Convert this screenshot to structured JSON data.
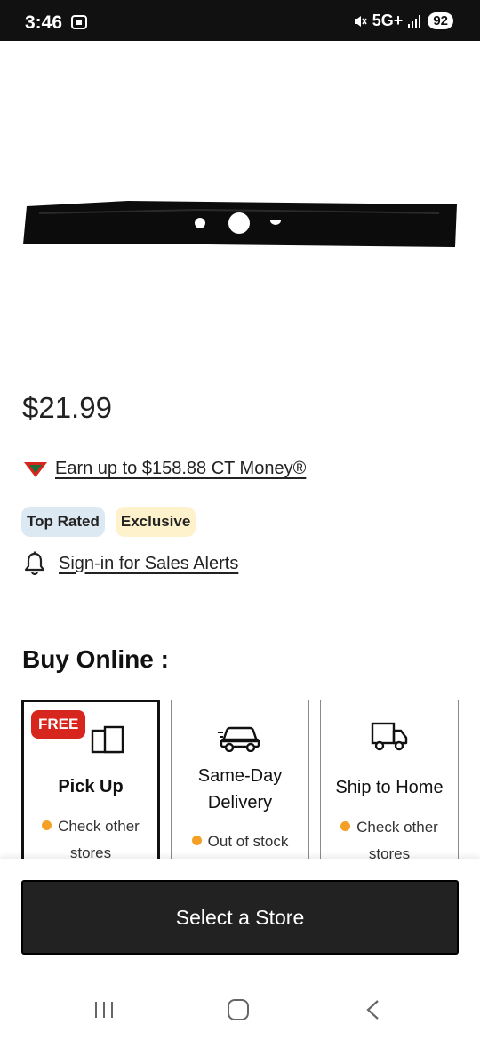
{
  "status_bar": {
    "time": "3:46",
    "network": "5G+",
    "battery": "92"
  },
  "product": {
    "price": "$21.99",
    "ct_money_link": "Earn up to $158.88 CT Money®",
    "badges": [
      "Top Rated",
      "Exclusive"
    ],
    "sales_alert_link": "Sign-in for Sales Alerts"
  },
  "buy_online": {
    "title": "Buy Online :",
    "options": [
      {
        "badge": "FREE",
        "title": "Pick Up",
        "status_line1": "Check other",
        "status_line2": "stores",
        "icon": "pickup-box-icon"
      },
      {
        "title_line1": "Same-Day",
        "title_line2": "Delivery",
        "status": "Out of stock",
        "icon": "car-icon"
      },
      {
        "title": "Ship to Home",
        "status_line1": "Check other",
        "status_line2": "stores",
        "icon": "truck-icon"
      }
    ],
    "status_dot_color": "#f4a025"
  },
  "cta": {
    "select_store": "Select a Store"
  },
  "colors": {
    "free_badge": "#d7261e",
    "top_rated_bg": "#dde9f2",
    "exclusive_bg": "#fdf2cc",
    "cta_bg": "#222222"
  }
}
